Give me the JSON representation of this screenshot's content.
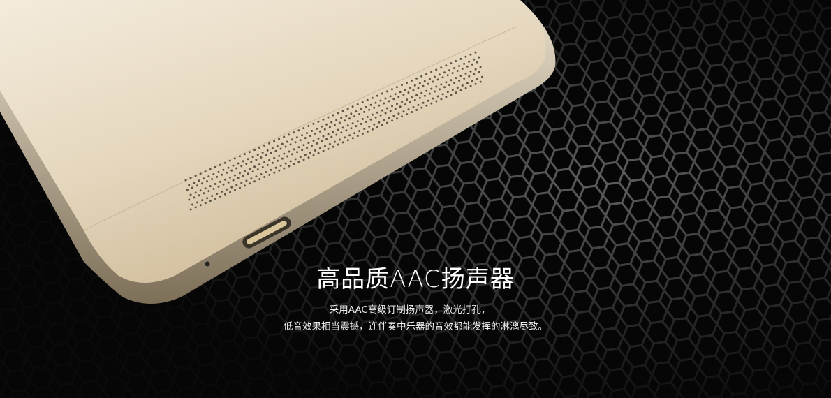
{
  "headline": "高品质AAC扬声器",
  "description": {
    "line1": "采用AAC高级订制扬声器，激光打孔，",
    "line2": "低音效果相当震撼，连伴奏中乐器的音效都能发挥的淋漓尽致。"
  },
  "colors": {
    "background": "#050505",
    "phone_gold": "#e8dcc6",
    "text": "#ffffff"
  }
}
